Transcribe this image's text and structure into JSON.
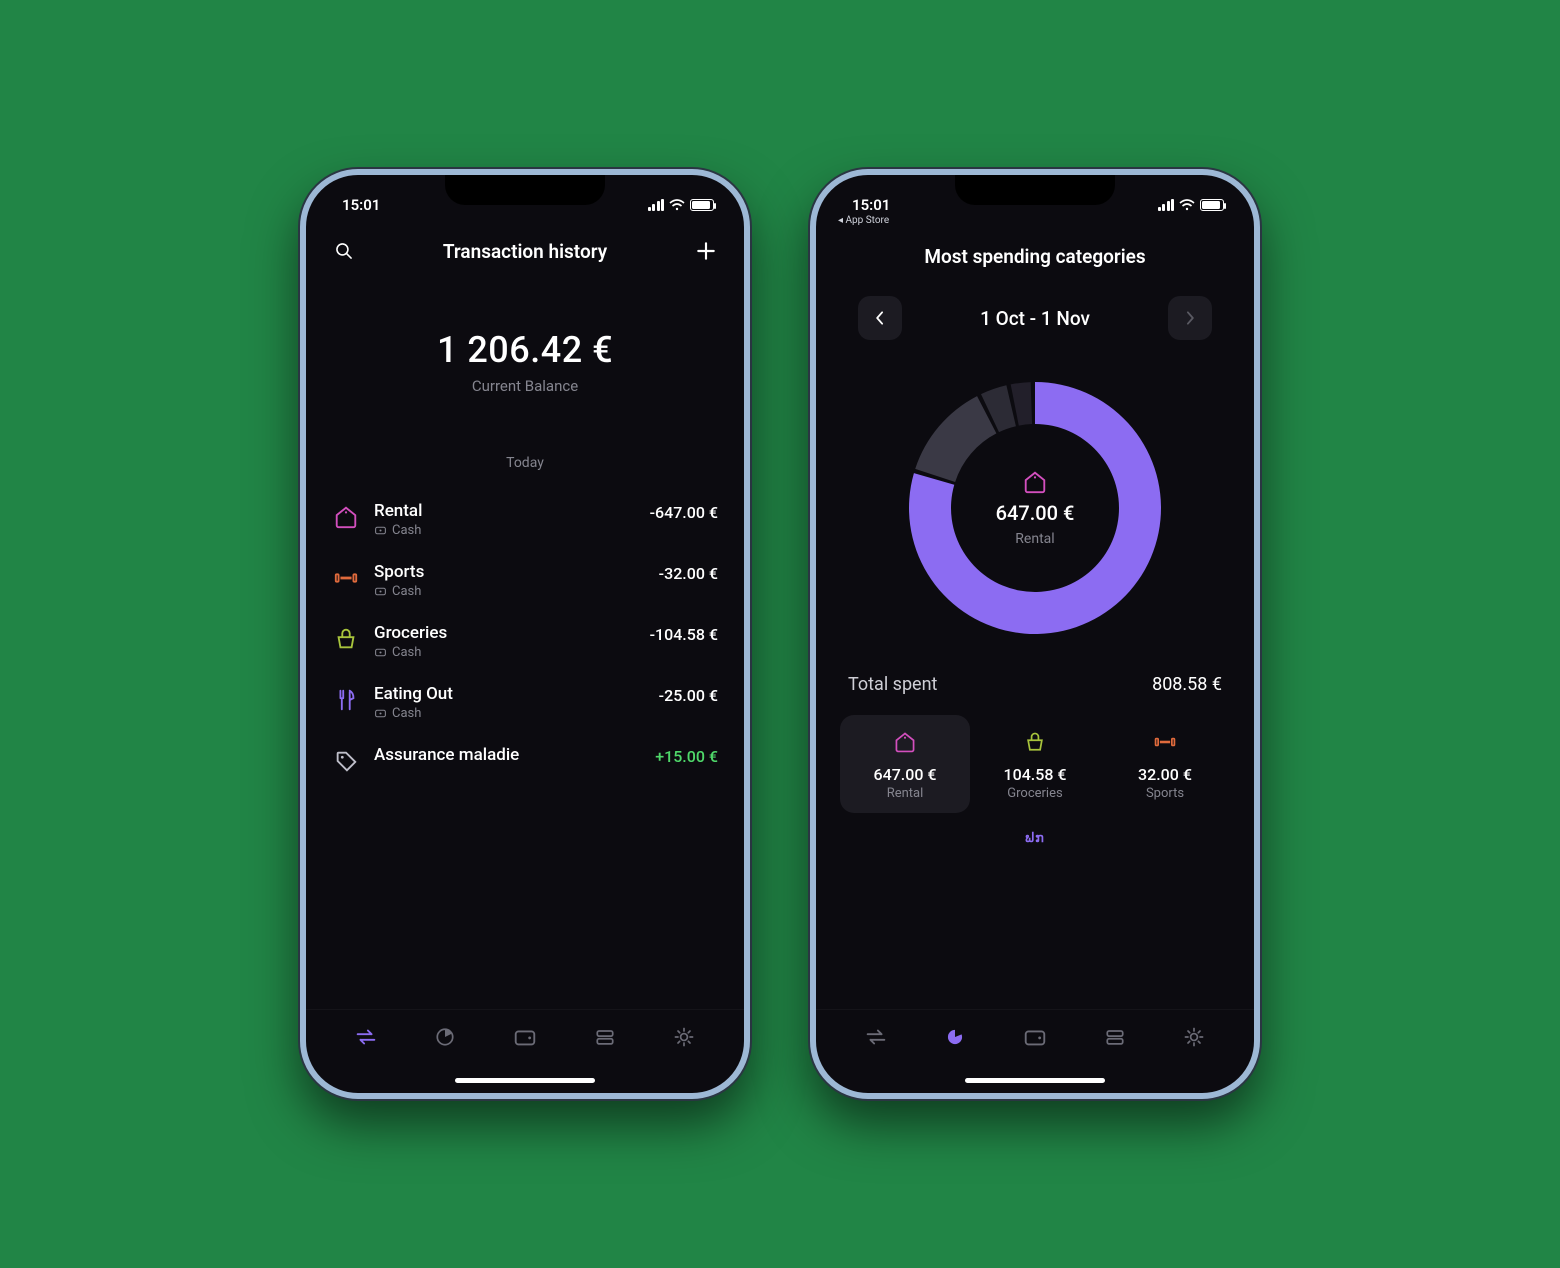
{
  "status": {
    "time": "15:01",
    "back_app": "◂ App Store"
  },
  "phone1": {
    "title": "Transaction history",
    "balance": {
      "value": "1 206.42 €",
      "label": "Current Balance"
    },
    "section": "Today",
    "transactions": [
      {
        "title": "Rental",
        "sub": "Cash",
        "amount": "-647.00 €",
        "icon": "house-icon",
        "color": "#d34fbe"
      },
      {
        "title": "Sports",
        "sub": "Cash",
        "amount": "-32.00 €",
        "icon": "dumbbell-icon",
        "color": "#e06a3c"
      },
      {
        "title": "Groceries",
        "sub": "Cash",
        "amount": "-104.58 €",
        "icon": "basket-icon",
        "color": "#a8c43c"
      },
      {
        "title": "Eating Out",
        "sub": "Cash",
        "amount": "-25.00 €",
        "icon": "fork-icon",
        "color": "#8c6cf2"
      },
      {
        "title": "Assurance maladie",
        "sub": "",
        "amount": "+15.00 €",
        "icon": "tag-icon",
        "color": "#bfbfca",
        "positive": true
      }
    ]
  },
  "phone2": {
    "title": "Most spending categories",
    "period": "1 Oct - 1 Nov",
    "center": {
      "amount": "647.00 €",
      "category": "Rental"
    },
    "total": {
      "label": "Total spent",
      "value": "808.58 €"
    },
    "cards": [
      {
        "amount": "647.00 €",
        "label": "Rental",
        "icon": "house-icon",
        "color": "#d34fbe",
        "selected": true
      },
      {
        "amount": "104.58 €",
        "label": "Groceries",
        "icon": "basket-icon",
        "color": "#a8c43c"
      },
      {
        "amount": "32.00 €",
        "label": "Sports",
        "icon": "dumbbell-icon",
        "color": "#e06a3c"
      }
    ],
    "mini": "ຟກ"
  },
  "chart_data": {
    "type": "pie",
    "title": "Most spending categories",
    "period": "1 Oct - 1 Nov",
    "total": 808.58,
    "currency": "€",
    "series": [
      {
        "name": "Rental",
        "value": 647.0,
        "color": "#8c6cf2"
      },
      {
        "name": "Groceries",
        "value": 104.58,
        "color": "#3a3945"
      },
      {
        "name": "Sports",
        "value": 32.0,
        "color": "#2c2b35"
      },
      {
        "name": "Eating Out",
        "value": 25.0,
        "color": "#221f2a"
      }
    ]
  }
}
